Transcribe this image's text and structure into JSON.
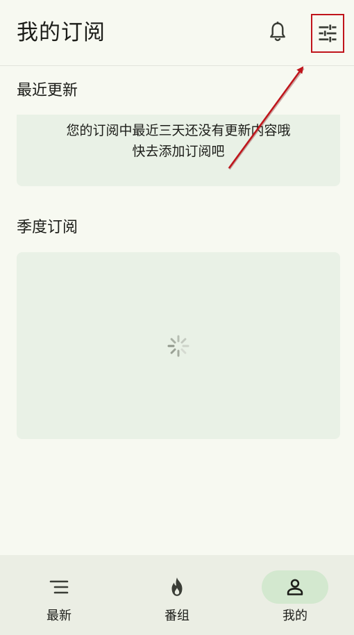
{
  "header": {
    "title": "我的订阅"
  },
  "sections": {
    "recent": {
      "title": "最近更新",
      "empty_line1": "您的订阅中最近三天还没有更新内容哦",
      "empty_line2": "快去添加订阅吧"
    },
    "season": {
      "title": "季度订阅",
      "state": "loading"
    }
  },
  "bottom_nav": {
    "items": [
      {
        "label": "最新",
        "icon": "list-icon"
      },
      {
        "label": "番组",
        "icon": "fire-icon"
      },
      {
        "label": "我的",
        "icon": "person-icon",
        "active": true
      }
    ]
  },
  "colors": {
    "background": "#f7f9f1",
    "card": "#e9f1e6",
    "nav_active": "#d3e8cf",
    "annotation": "#c0141b"
  }
}
